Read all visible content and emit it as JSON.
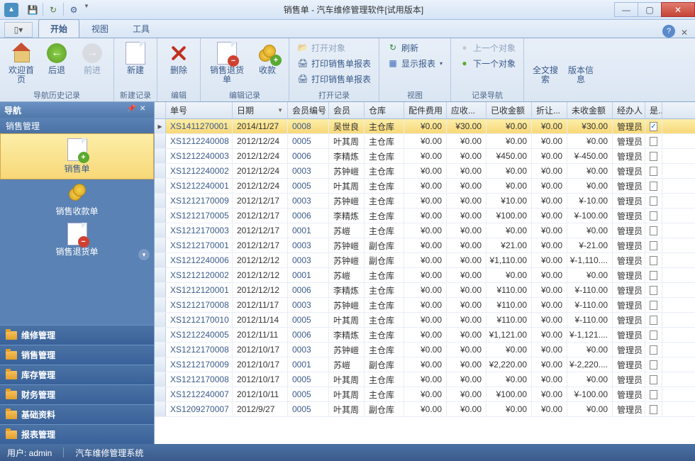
{
  "window": {
    "title": "销售单 - 汽车维修管理软件[试用版本]"
  },
  "tabs": {
    "start": "开始",
    "view": "视图",
    "tools": "工具"
  },
  "ribbon": {
    "groups": {
      "nav_history": "导航历史记录",
      "new_record": "新建记录",
      "edit": "编辑",
      "edit_record": "编辑记录",
      "open_record": "打开记录",
      "view": "视图",
      "record_nav": "记录导航"
    },
    "buttons": {
      "welcome": "欢迎首页",
      "back": "后退",
      "forward": "前进",
      "new": "新建",
      "delete": "删除",
      "sales_return": "销售退货单",
      "collect": "收款",
      "open_obj": "打开对象",
      "print_rep1": "打印销售单报表",
      "print_rep2": "打印销售单报表",
      "refresh": "刷新",
      "show_report": "显示报表",
      "prev_obj": "上一个对象",
      "next_obj": "下一个对象",
      "fulltext": "全文搜索",
      "version": "版本信息"
    }
  },
  "sidebar": {
    "title": "导航",
    "section": "销售管理",
    "active_item": "销售单",
    "item_receipt": "销售收款单",
    "item_return": "销售退货单",
    "cats": {
      "repair": "维修管理",
      "sales": "销售管理",
      "stock": "库存管理",
      "finance": "财务管理",
      "base": "基础资料",
      "report": "报表管理"
    }
  },
  "grid": {
    "cols": {
      "no": "单号",
      "date": "日期",
      "member_no": "会员编号",
      "member": "会员",
      "wh": "仓库",
      "parts_fee": "配件费用",
      "recv": "应收...",
      "paid": "已收金额",
      "disc": "折让...",
      "unpaid": "未收金额",
      "handler": "经办人",
      "is": "是..."
    },
    "rows": [
      {
        "no": "XS1411270001",
        "date": "2014/11/27",
        "mno": "0008",
        "mem": "吴世良",
        "wh": "主仓库",
        "pf": "¥0.00",
        "ar": "¥30.00",
        "paid": "¥0.00",
        "disc": "¥0.00",
        "up": "¥30.00",
        "h": "管理员",
        "chk": true,
        "sel": true
      },
      {
        "no": "XS1212240008",
        "date": "2012/12/24",
        "mno": "0005",
        "mem": "叶其周",
        "wh": "主仓库",
        "pf": "¥0.00",
        "ar": "¥0.00",
        "paid": "¥0.00",
        "disc": "¥0.00",
        "up": "¥0.00",
        "h": "管理员",
        "chk": false
      },
      {
        "no": "XS1212240003",
        "date": "2012/12/24",
        "mno": "0006",
        "mem": "李精炼",
        "wh": "主仓库",
        "pf": "¥0.00",
        "ar": "¥0.00",
        "paid": "¥450.00",
        "disc": "¥0.00",
        "up": "¥-450.00",
        "h": "管理员",
        "chk": false
      },
      {
        "no": "XS1212240002",
        "date": "2012/12/24",
        "mno": "0003",
        "mem": "苏钟嵦",
        "wh": "主仓库",
        "pf": "¥0.00",
        "ar": "¥0.00",
        "paid": "¥0.00",
        "disc": "¥0.00",
        "up": "¥0.00",
        "h": "管理员",
        "chk": false
      },
      {
        "no": "XS1212240001",
        "date": "2012/12/24",
        "mno": "0005",
        "mem": "叶其周",
        "wh": "主仓库",
        "pf": "¥0.00",
        "ar": "¥0.00",
        "paid": "¥0.00",
        "disc": "¥0.00",
        "up": "¥0.00",
        "h": "管理员",
        "chk": false
      },
      {
        "no": "XS1212170009",
        "date": "2012/12/17",
        "mno": "0003",
        "mem": "苏钟嵦",
        "wh": "主仓库",
        "pf": "¥0.00",
        "ar": "¥0.00",
        "paid": "¥10.00",
        "disc": "¥0.00",
        "up": "¥-10.00",
        "h": "管理员",
        "chk": false
      },
      {
        "no": "XS1212170005",
        "date": "2012/12/17",
        "mno": "0006",
        "mem": "李精炼",
        "wh": "主仓库",
        "pf": "¥0.00",
        "ar": "¥0.00",
        "paid": "¥100.00",
        "disc": "¥0.00",
        "up": "¥-100.00",
        "h": "管理员",
        "chk": false
      },
      {
        "no": "XS1212170003",
        "date": "2012/12/17",
        "mno": "0001",
        "mem": "苏嵦",
        "wh": "主仓库",
        "pf": "¥0.00",
        "ar": "¥0.00",
        "paid": "¥0.00",
        "disc": "¥0.00",
        "up": "¥0.00",
        "h": "管理员",
        "chk": false
      },
      {
        "no": "XS1212170001",
        "date": "2012/12/17",
        "mno": "0003",
        "mem": "苏钟嵦",
        "wh": "副仓库",
        "pf": "¥0.00",
        "ar": "¥0.00",
        "paid": "¥21.00",
        "disc": "¥0.00",
        "up": "¥-21.00",
        "h": "管理员",
        "chk": false
      },
      {
        "no": "XS1212240006",
        "date": "2012/12/12",
        "mno": "0003",
        "mem": "苏钟嵦",
        "wh": "副仓库",
        "pf": "¥0.00",
        "ar": "¥0.00",
        "paid": "¥1,110.00",
        "disc": "¥0.00",
        "up": "¥-1,110....",
        "h": "管理员",
        "chk": false
      },
      {
        "no": "XS1212120002",
        "date": "2012/12/12",
        "mno": "0001",
        "mem": "苏嵦",
        "wh": "主仓库",
        "pf": "¥0.00",
        "ar": "¥0.00",
        "paid": "¥0.00",
        "disc": "¥0.00",
        "up": "¥0.00",
        "h": "管理员",
        "chk": false
      },
      {
        "no": "XS1212120001",
        "date": "2012/12/12",
        "mno": "0006",
        "mem": "李精炼",
        "wh": "主仓库",
        "pf": "¥0.00",
        "ar": "¥0.00",
        "paid": "¥110.00",
        "disc": "¥0.00",
        "up": "¥-110.00",
        "h": "管理员",
        "chk": false
      },
      {
        "no": "XS1212170008",
        "date": "2012/11/17",
        "mno": "0003",
        "mem": "苏钟嵦",
        "wh": "主仓库",
        "pf": "¥0.00",
        "ar": "¥0.00",
        "paid": "¥110.00",
        "disc": "¥0.00",
        "up": "¥-110.00",
        "h": "管理员",
        "chk": false
      },
      {
        "no": "XS1212170010",
        "date": "2012/11/14",
        "mno": "0005",
        "mem": "叶其周",
        "wh": "主仓库",
        "pf": "¥0.00",
        "ar": "¥0.00",
        "paid": "¥110.00",
        "disc": "¥0.00",
        "up": "¥-110.00",
        "h": "管理员",
        "chk": false
      },
      {
        "no": "XS1212240005",
        "date": "2012/11/11",
        "mno": "0006",
        "mem": "李精炼",
        "wh": "主仓库",
        "pf": "¥0.00",
        "ar": "¥0.00",
        "paid": "¥1,121.00",
        "disc": "¥0.00",
        "up": "¥-1,121....",
        "h": "管理员",
        "chk": false
      },
      {
        "no": "XS1212170008",
        "date": "2012/10/17",
        "mno": "0003",
        "mem": "苏钟嵦",
        "wh": "主仓库",
        "pf": "¥0.00",
        "ar": "¥0.00",
        "paid": "¥0.00",
        "disc": "¥0.00",
        "up": "¥0.00",
        "h": "管理员",
        "chk": false
      },
      {
        "no": "XS1212170009",
        "date": "2012/10/17",
        "mno": "0001",
        "mem": "苏嵦",
        "wh": "副仓库",
        "pf": "¥0.00",
        "ar": "¥0.00",
        "paid": "¥2,220.00",
        "disc": "¥0.00",
        "up": "¥-2,220....",
        "h": "管理员",
        "chk": false
      },
      {
        "no": "XS1212170008",
        "date": "2012/10/17",
        "mno": "0005",
        "mem": "叶其周",
        "wh": "主仓库",
        "pf": "¥0.00",
        "ar": "¥0.00",
        "paid": "¥0.00",
        "disc": "¥0.00",
        "up": "¥0.00",
        "h": "管理员",
        "chk": false
      },
      {
        "no": "XS1212240007",
        "date": "2012/10/11",
        "mno": "0005",
        "mem": "叶其周",
        "wh": "主仓库",
        "pf": "¥0.00",
        "ar": "¥0.00",
        "paid": "¥100.00",
        "disc": "¥0.00",
        "up": "¥-100.00",
        "h": "管理员",
        "chk": false
      },
      {
        "no": "XS1209270007",
        "date": "2012/9/27",
        "mno": "0005",
        "mem": "叶其周",
        "wh": "副仓库",
        "pf": "¥0.00",
        "ar": "¥0.00",
        "paid": "¥0.00",
        "disc": "¥0.00",
        "up": "¥0.00",
        "h": "管理员",
        "chk": false
      }
    ]
  },
  "status": {
    "user": "用户: admin",
    "app": "汽车维修管理系统"
  }
}
